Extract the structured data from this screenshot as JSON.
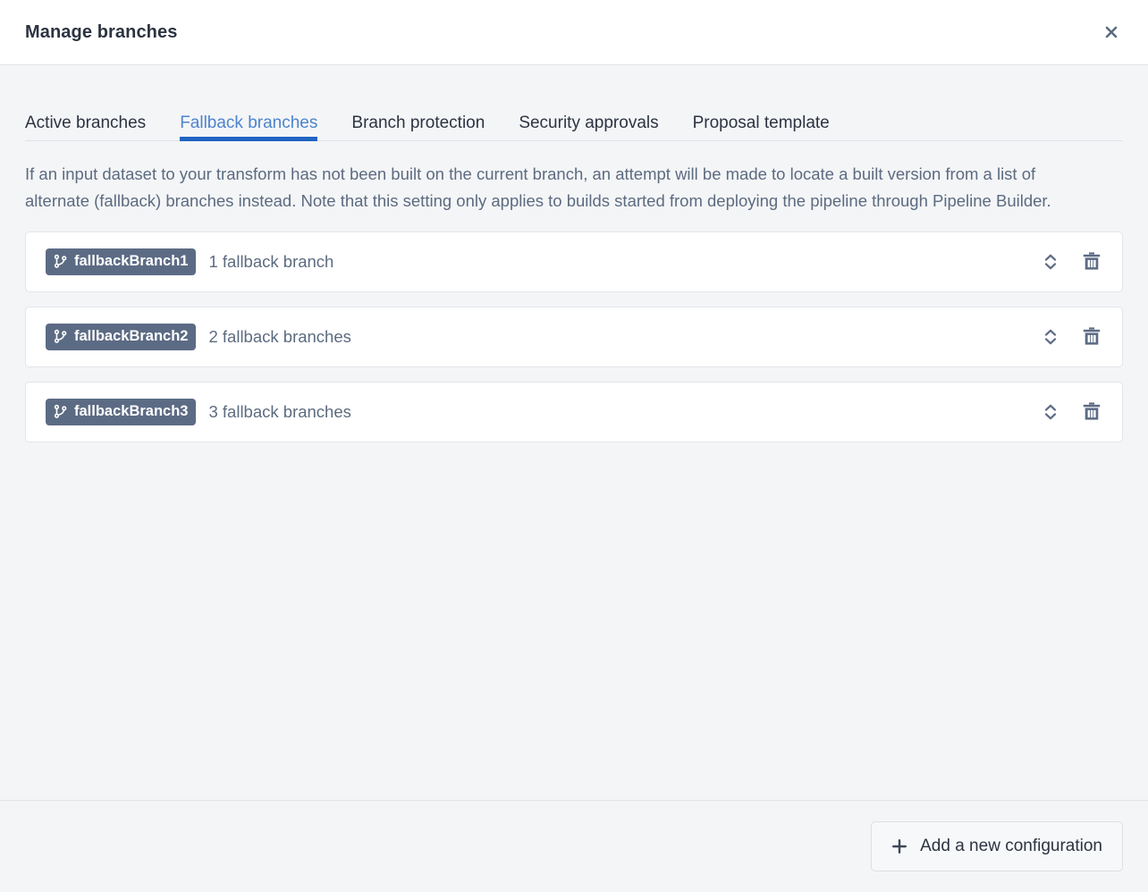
{
  "dialog": {
    "title": "Manage branches",
    "close_icon": "close-icon",
    "close_label": "×"
  },
  "tabs": [
    {
      "label": "Active branches",
      "active": false
    },
    {
      "label": "Fallback branches",
      "active": true
    },
    {
      "label": "Branch protection",
      "active": false
    },
    {
      "label": "Security approvals",
      "active": false
    },
    {
      "label": "Proposal template",
      "active": false
    }
  ],
  "description": "If an input dataset to your transform has not been built on the current branch, an attempt will be made to locate a built version from a list of alternate (fallback) branches instead. Note that this setting only applies to builds started from deploying the pipeline through Pipeline Builder.",
  "configurations": [
    {
      "branch": "fallbackBranch1",
      "summary": "1 fallback branch",
      "branch_icon": "git-branch-icon",
      "reorder_icon": "chevron-up-down-icon",
      "delete_icon": "trash-icon"
    },
    {
      "branch": "fallbackBranch2",
      "summary": "2 fallback branches",
      "branch_icon": "git-branch-icon",
      "reorder_icon": "chevron-up-down-icon",
      "delete_icon": "trash-icon"
    },
    {
      "branch": "fallbackBranch3",
      "summary": "3 fallback branches",
      "branch_icon": "git-branch-icon",
      "reorder_icon": "chevron-up-down-icon",
      "delete_icon": "trash-icon"
    }
  ],
  "footer": {
    "add_button_label": "Add a new configuration",
    "add_button_icon": "plus-icon"
  },
  "colors": {
    "accent_blue": "#2063c3",
    "active_tab_text": "#4d84cd",
    "branch_tag_bg": "#5c6b84",
    "body_bg": "#f4f5f7",
    "card_bg": "#ffffff",
    "muted_text": "#5c6b80",
    "title_text": "#2c3341",
    "border": "#e3e5e9"
  }
}
